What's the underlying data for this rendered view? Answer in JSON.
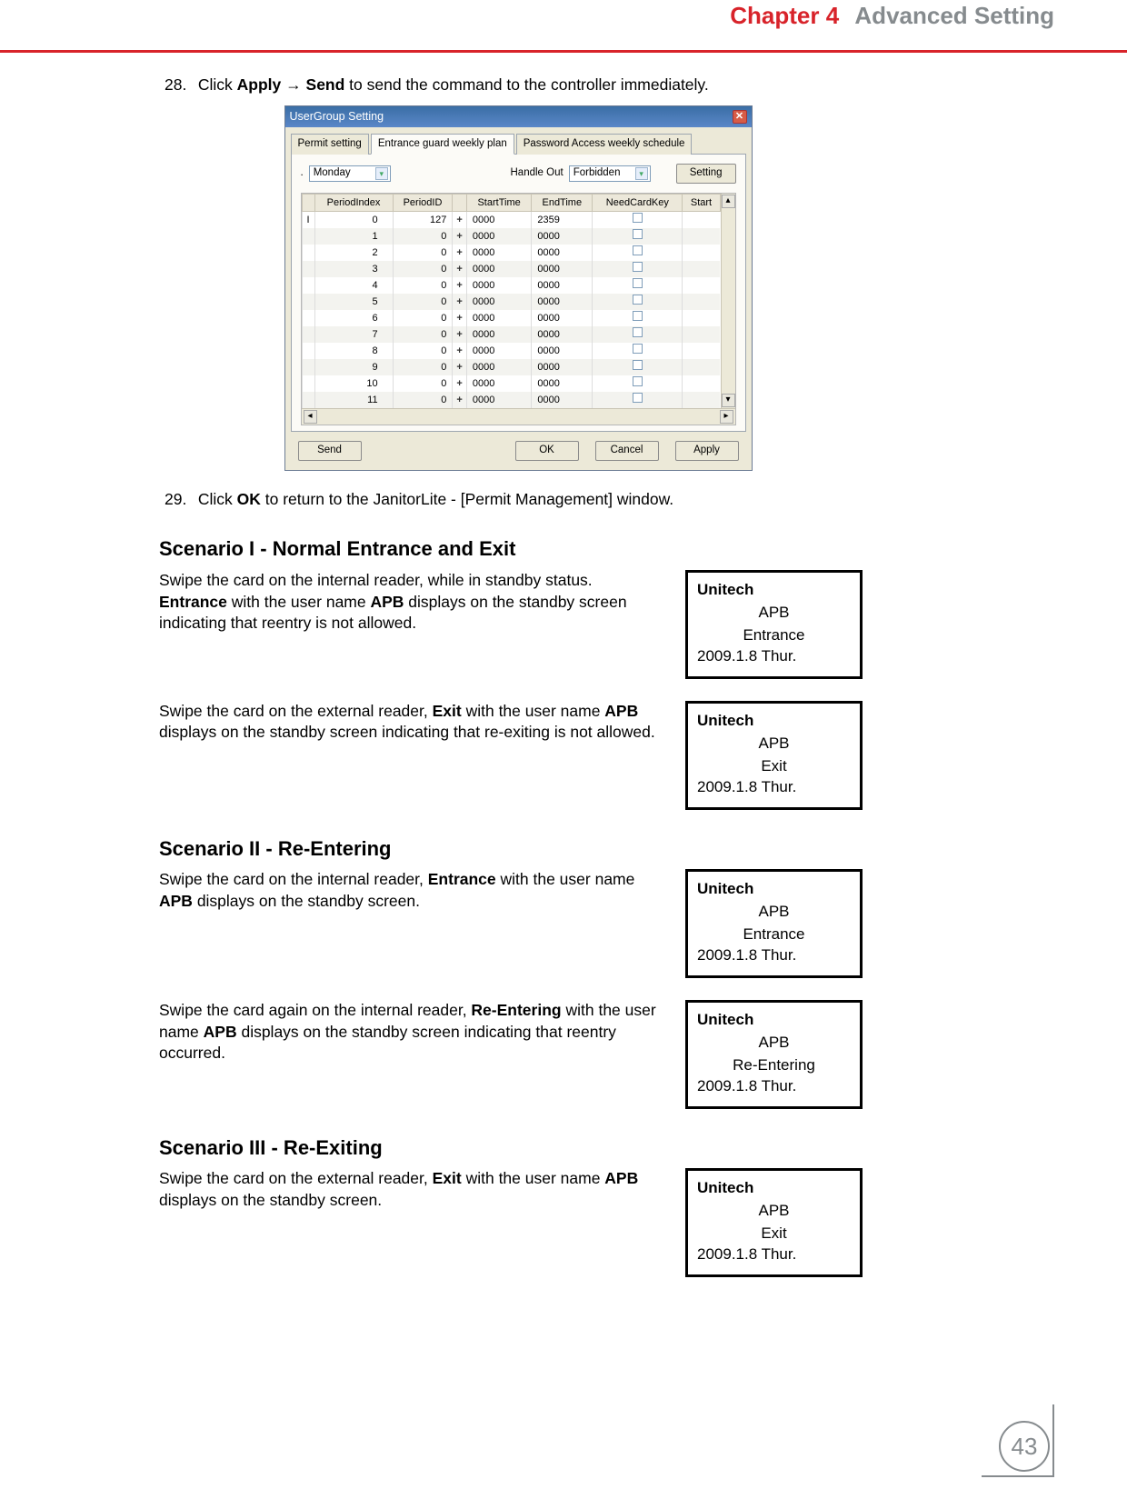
{
  "header": {
    "chapter": "Chapter 4",
    "title": "Advanced Setting"
  },
  "steps": {
    "s28": {
      "num": "28.",
      "t1": "Click ",
      "b1": "Apply",
      "arrow": " → ",
      "b2": "Send",
      "t2": " to send the command to the controller immediately."
    },
    "s29": {
      "num": "29.",
      "t1": "Click ",
      "b1": "OK",
      "t2": " to return to the JanitorLite - [Permit Management] window."
    }
  },
  "dlg": {
    "title": "UserGroup Setting",
    "tabs": [
      "Permit setting",
      "Entrance guard weekly plan",
      "Password Access weekly schedule"
    ],
    "daylabel": ".",
    "day": "Monday",
    "houtlbl": "Handle Out",
    "hout": "Forbidden",
    "settingbtn": "Setting",
    "cols": [
      "PeriodIndex",
      "PeriodID",
      "StartTime",
      "EndTime",
      "NeedCardKey",
      "Start"
    ],
    "rows": [
      {
        "idx": "0",
        "pid": "127",
        "st": "0000",
        "et": "2359"
      },
      {
        "idx": "1",
        "pid": "0",
        "st": "0000",
        "et": "0000"
      },
      {
        "idx": "2",
        "pid": "0",
        "st": "0000",
        "et": "0000"
      },
      {
        "idx": "3",
        "pid": "0",
        "st": "0000",
        "et": "0000"
      },
      {
        "idx": "4",
        "pid": "0",
        "st": "0000",
        "et": "0000"
      },
      {
        "idx": "5",
        "pid": "0",
        "st": "0000",
        "et": "0000"
      },
      {
        "idx": "6",
        "pid": "0",
        "st": "0000",
        "et": "0000"
      },
      {
        "idx": "7",
        "pid": "0",
        "st": "0000",
        "et": "0000"
      },
      {
        "idx": "8",
        "pid": "0",
        "st": "0000",
        "et": "0000"
      },
      {
        "idx": "9",
        "pid": "0",
        "st": "0000",
        "et": "0000"
      },
      {
        "idx": "10",
        "pid": "0",
        "st": "0000",
        "et": "0000"
      },
      {
        "idx": "11",
        "pid": "0",
        "st": "0000",
        "et": "0000"
      }
    ],
    "btns": {
      "send": "Send",
      "ok": "OK",
      "cancel": "Cancel",
      "apply": "Apply"
    }
  },
  "scen1": {
    "h": "Scenario I - Normal Entrance and Exit",
    "p1a": "Swipe the card on the internal reader, while in standby status. ",
    "p1b": "Entrance",
    "p1c": " with the user name ",
    "p1d": "APB",
    "p1e": " displays on the standby screen indicating that reentry is not allowed.",
    "p2a": "Swipe the card on the external reader, ",
    "p2b": "Exit",
    "p2c": " with the user name ",
    "p2d": "APB",
    "p2e": " displays on the standby screen indicating that re-exiting is not allowed."
  },
  "scen2": {
    "h": "Scenario II - Re-Entering",
    "p1a": "Swipe the card on the internal reader, ",
    "p1b": "Entrance",
    "p1c": " with the user name ",
    "p1d": "APB",
    "p1e": " displays on the standby screen.",
    "p2a": "Swipe the card again on the internal reader, ",
    "p2b": "Re-Entering",
    "p2c": " with the user name ",
    "p2d": "APB",
    "p2e": " displays on the standby screen indicating that reentry occurred."
  },
  "scen3": {
    "h": "Scenario III - Re-Exiting",
    "p1a": "Swipe the card on the external reader, ",
    "p1b": "Exit",
    "p1c": " with the user name ",
    "p1d": "APB",
    "p1e": " displays on the standby screen."
  },
  "lcd": {
    "brand": "Unitech",
    "apb": "APB",
    "entr": "Entrance",
    "exit": "Exit",
    "reent": "Re-Entering",
    "date": "2009.1.8 Thur."
  },
  "pagenum": "43"
}
